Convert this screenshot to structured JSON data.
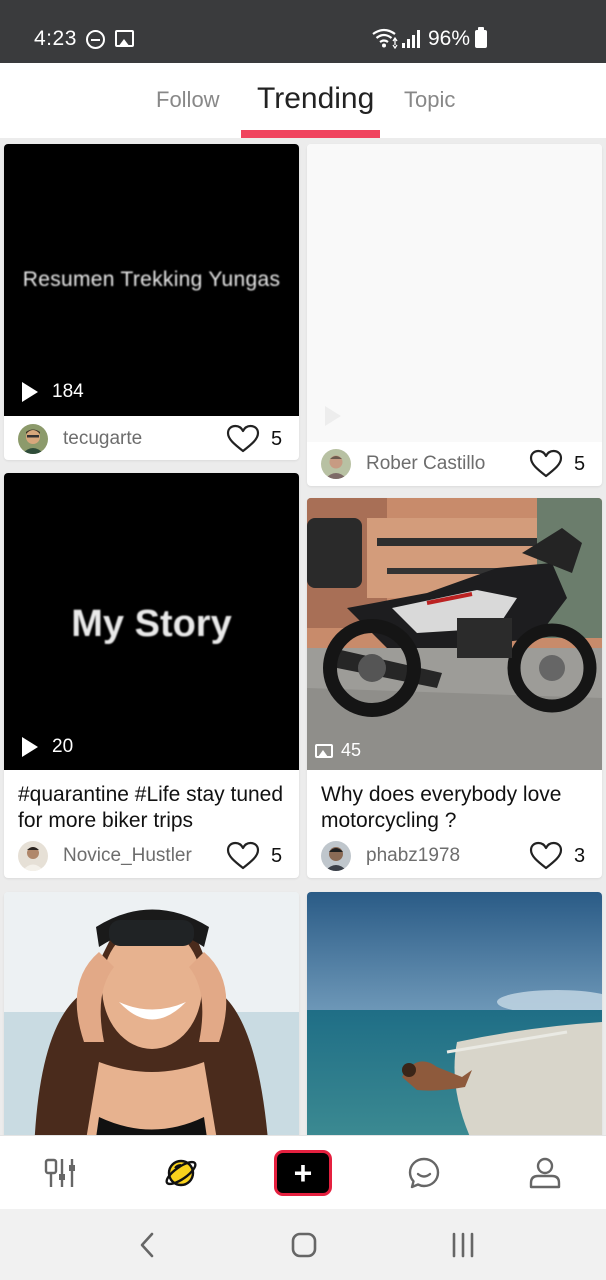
{
  "status_bar": {
    "time": "4:23",
    "battery_text": "96%",
    "icons": [
      "do-not-disturb-icon",
      "gallery-icon",
      "wifi-icon",
      "signal-icon",
      "battery-icon"
    ]
  },
  "tabs": [
    {
      "label": "Follow",
      "active": false
    },
    {
      "label": "Trending",
      "active": true
    },
    {
      "label": "Topic",
      "active": false
    }
  ],
  "accent_color": "#f0435e",
  "posts": [
    {
      "overlay_title": "Resumen Trekking Yungas",
      "media": "video",
      "media_count": "184",
      "caption": "",
      "username": "tecugarte",
      "likes": "5"
    },
    {
      "overlay_title": "",
      "media": "video",
      "media_count": "",
      "caption": "",
      "username": "Rober Castillo",
      "likes": "5"
    },
    {
      "overlay_title": "My Story",
      "media": "video",
      "media_count": "20",
      "caption": "#quarantine #Life stay tuned for more biker trips",
      "username": "Novice_Hustler",
      "likes": "5"
    },
    {
      "overlay_title": "",
      "media": "image",
      "media_count": "45",
      "caption": "Why does everybody love motorcycling ?",
      "username": "phabz1978",
      "likes": "3"
    },
    {
      "overlay_title": "",
      "media": "image",
      "media_count": "",
      "caption": "",
      "username": "",
      "likes": ""
    },
    {
      "overlay_title": "",
      "media": "image",
      "media_count": "",
      "caption": "",
      "username": "",
      "likes": ""
    }
  ],
  "bottom_nav": [
    {
      "icon": "tools-icon",
      "active": false
    },
    {
      "icon": "planet-icon",
      "active": true
    },
    {
      "icon": "add-post-icon",
      "label": "+"
    },
    {
      "icon": "chat-icon",
      "active": false
    },
    {
      "icon": "profile-icon",
      "active": false
    }
  ],
  "system_nav": [
    "back-icon",
    "home-icon",
    "recents-icon"
  ]
}
